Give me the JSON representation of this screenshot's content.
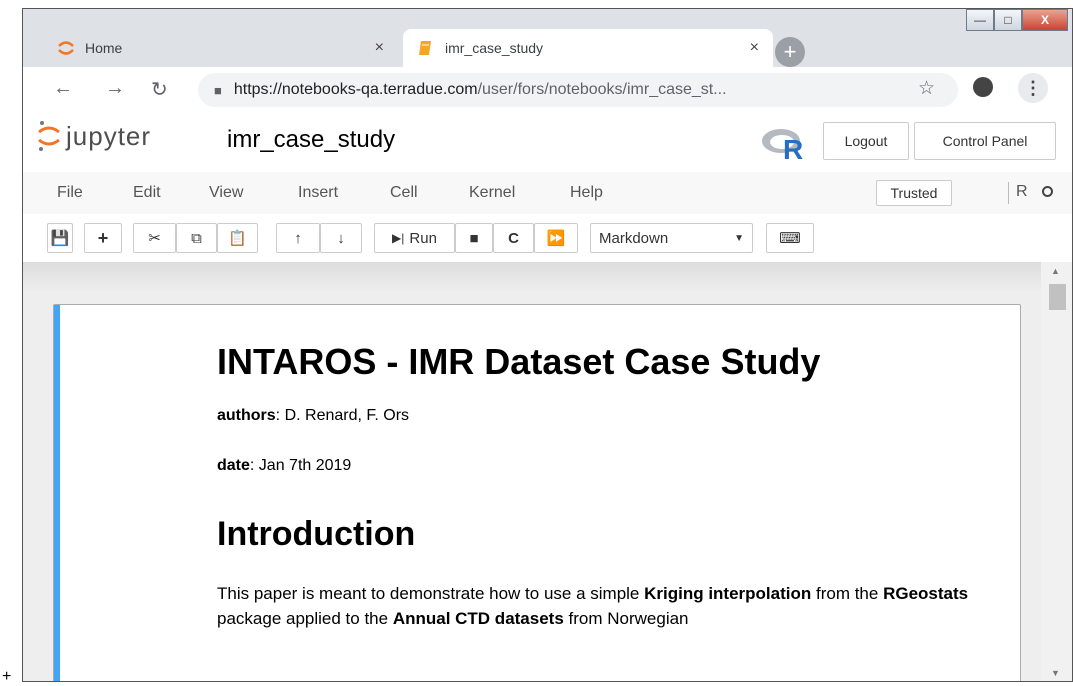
{
  "browser": {
    "tabs": [
      {
        "title": "Home",
        "icon": "jupyter-logo-icon",
        "active": false
      },
      {
        "title": "imr_case_study",
        "icon": "notebook-icon",
        "active": true
      }
    ],
    "tab_close_glyph": "×",
    "new_tab_glyph": "+",
    "url_host": "https://notebooks-qa.terradue.com",
    "url_path": "/user/fors/notebooks/imr_case_st...",
    "window_buttons": [
      "minimize",
      "maximize",
      "close"
    ]
  },
  "jupyter": {
    "logo_text": "jupyter",
    "notebook_name": "imr_case_study",
    "logout_label": "Logout",
    "control_panel_label": "Control Panel",
    "menu": [
      "File",
      "Edit",
      "View",
      "Insert",
      "Cell",
      "Kernel",
      "Help"
    ],
    "trusted_label": "Trusted",
    "kernel_name": "R",
    "run_label": "Run",
    "cell_type": "Markdown"
  },
  "cell": {
    "title": "INTAROS - IMR Dataset Case Study",
    "authors_label": "authors",
    "authors_value": ": D. Renard, F. Ors",
    "date_label": "date",
    "date_value": ": Jan 7th 2019",
    "section_heading": "Introduction",
    "intro_1": "This paper is meant to demonstrate how to use a simple ",
    "intro_b1": "Kriging interpolation",
    "intro_2": " from the ",
    "intro_b2": "RGeostats",
    "intro_3": " package applied to the ",
    "intro_b3": "Annual CTD datasets",
    "intro_4": " from Norwegian"
  },
  "colors": {
    "cell_accent": "#42a5f5",
    "jupyter_orange": "#f37626",
    "r_blue": "#276dc3"
  }
}
